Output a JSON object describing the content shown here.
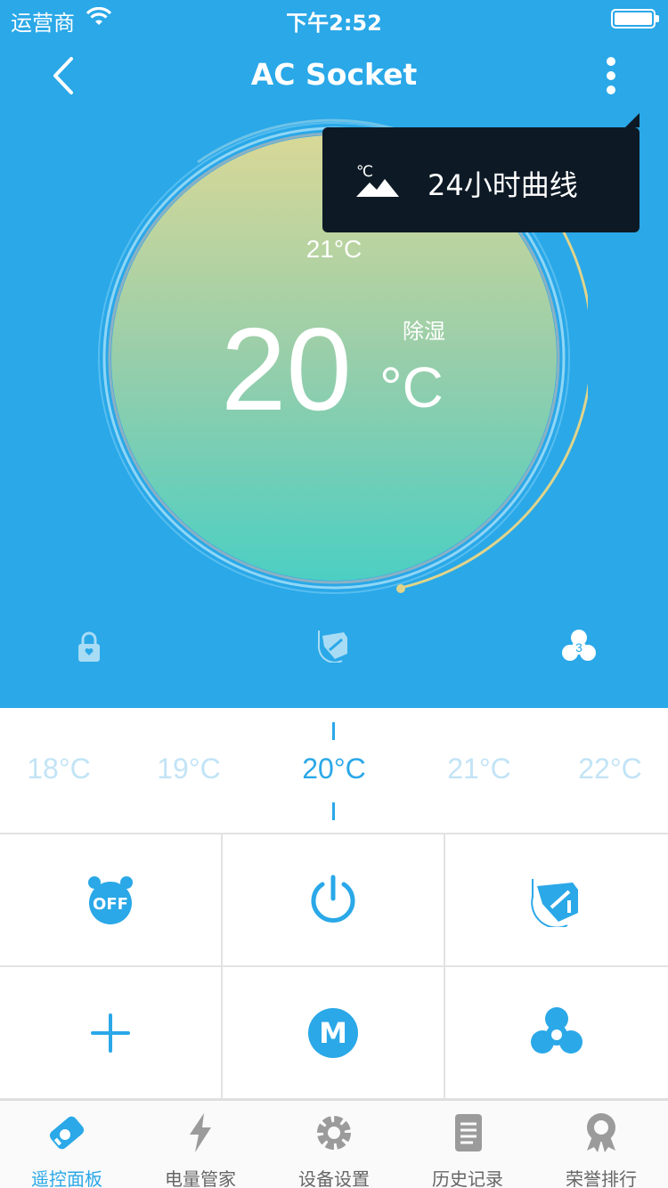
{
  "status_bar": {
    "carrier": "运营商",
    "time": "下午2:52"
  },
  "header": {
    "title": "AC Socket"
  },
  "tooltip_menu": {
    "item_label": "24小时曲线",
    "icon": "temperature-landscape-icon"
  },
  "dial": {
    "set_temperature": "20",
    "unit": "°C",
    "room_temperature": "21°C",
    "mode": "除湿"
  },
  "status_icons": {
    "fan_speed": "3"
  },
  "temperature_scale": {
    "items": [
      "18°C",
      "19°C",
      "20°C",
      "21°C",
      "22°C"
    ],
    "selected": "20°C"
  },
  "controls": {
    "timer_off": "OFF",
    "mode_letter": "M"
  },
  "tabs": [
    {
      "label": "遥控面板",
      "icon": "remote-control-icon",
      "active": true
    },
    {
      "label": "电量管家",
      "icon": "lightning-icon",
      "active": false
    },
    {
      "label": "设备设置",
      "icon": "gear-icon",
      "active": false
    },
    {
      "label": "历史记录",
      "icon": "document-icon",
      "active": false
    },
    {
      "label": "荣誉排行",
      "icon": "medal-icon",
      "active": false
    }
  ],
  "colors": {
    "primary": "#2aa8e8",
    "tooltip_bg": "#0d1a26",
    "dial_top": "#d6d696",
    "dial_bottom": "#4dcfc4"
  }
}
